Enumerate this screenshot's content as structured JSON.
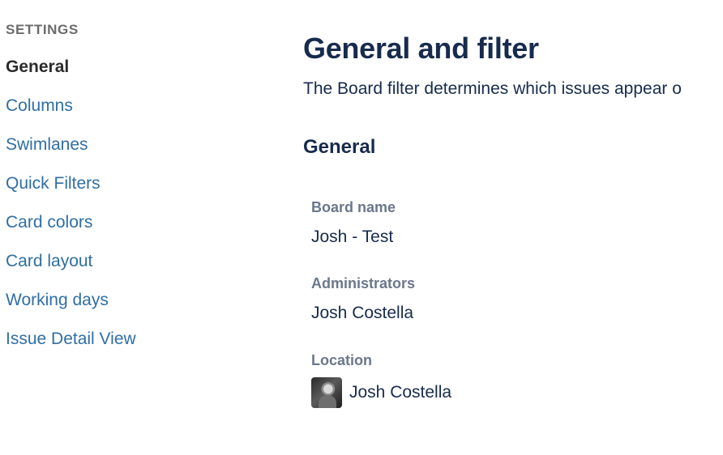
{
  "sidebar": {
    "heading": "SETTINGS",
    "items": [
      {
        "label": "General",
        "active": true
      },
      {
        "label": "Columns",
        "active": false
      },
      {
        "label": "Swimlanes",
        "active": false
      },
      {
        "label": "Quick Filters",
        "active": false
      },
      {
        "label": "Card colors",
        "active": false
      },
      {
        "label": "Card layout",
        "active": false
      },
      {
        "label": "Working days",
        "active": false
      },
      {
        "label": "Issue Detail View",
        "active": false
      }
    ]
  },
  "main": {
    "title": "General and filter",
    "description": "The Board filter determines which issues appear o",
    "section_title": "General",
    "fields": {
      "board_name": {
        "label": "Board name",
        "value": "Josh - Test"
      },
      "administrators": {
        "label": "Administrators",
        "value": "Josh Costella"
      },
      "location": {
        "label": "Location",
        "value": "Josh Costella",
        "avatar_icon": "user-avatar-icon"
      }
    }
  },
  "colors": {
    "link": "#2f6ea5",
    "active_nav": "#2b2b2b",
    "heading": "#172b4d",
    "field_label": "#6b778c",
    "sidebar_heading": "#6b6b6b"
  }
}
